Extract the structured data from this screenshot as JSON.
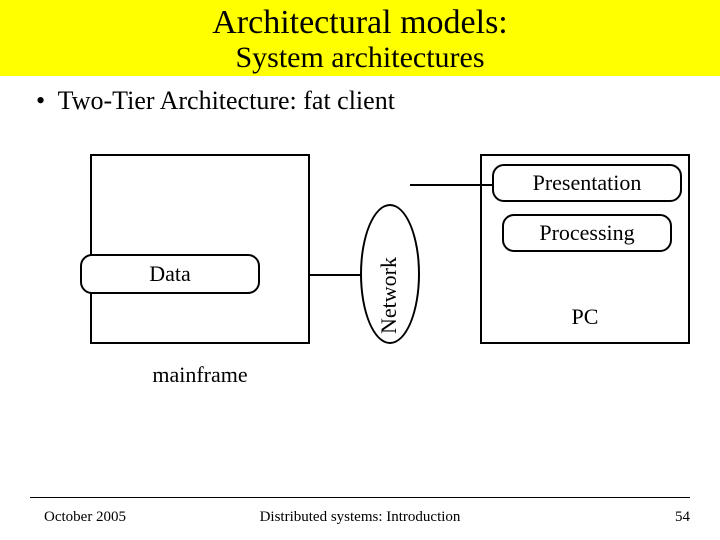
{
  "header": {
    "title1": "Architectural models:",
    "title2": "System architectures"
  },
  "bullet": "Two-Tier Architecture: fat client",
  "diagram": {
    "left_box": {
      "data_label": "Data",
      "caption": "mainframe"
    },
    "network_label": "Network",
    "right_box": {
      "presentation_label": "Presentation",
      "processing_label": "Processing",
      "caption": "PC"
    }
  },
  "footer": {
    "date": "October 2005",
    "center": "Distributed systems: Introduction",
    "page": "54"
  }
}
